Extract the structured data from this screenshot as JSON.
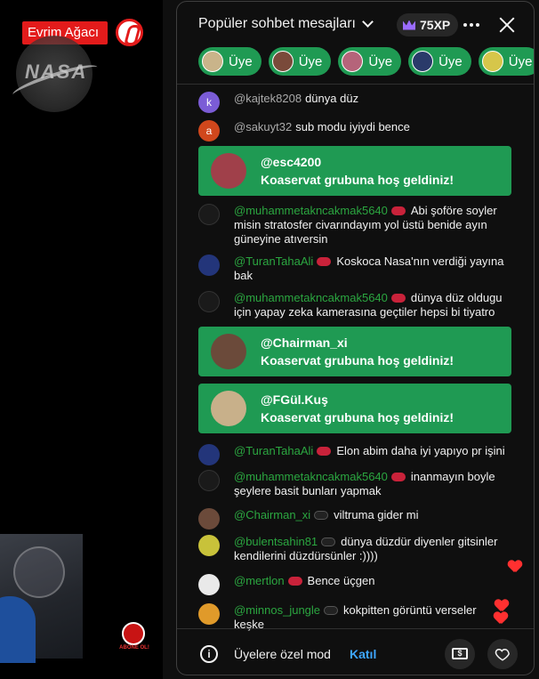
{
  "video": {
    "channel_badge": "Evrim Ağacı",
    "nasa_logo": "NASA",
    "subscribe_logo": "ABONE OL!"
  },
  "header": {
    "title": "Popüler sohbet mesajları",
    "xp": "75XP",
    "icons": [
      "chevron-down-icon",
      "crown-icon",
      "more-vert-icon",
      "close-icon"
    ]
  },
  "chips": [
    {
      "label": "Üye",
      "avatar_color": "#c9b48a"
    },
    {
      "label": "Üye",
      "avatar_color": "#7a4a3a"
    },
    {
      "label": "Üye",
      "avatar_color": "#b5647a"
    },
    {
      "label": "Üye",
      "avatar_color": "#2a3a6a"
    },
    {
      "label": "Üye",
      "avatar_color": "#d6c64a"
    }
  ],
  "messages": [
    {
      "type": "text",
      "avatar_letter": "k",
      "avatar_color": "#7b5cd6",
      "author": "@kajtek8208",
      "member": false,
      "text": "dünya düz"
    },
    {
      "type": "text",
      "avatar_letter": "a",
      "avatar_color": "#d0471c",
      "author": "@sakuyt32",
      "member": false,
      "text": "sub modu iyiydi bence"
    },
    {
      "type": "welcome",
      "author": "@esc4200",
      "text": "Koaservat grubuna hoş geldiniz!",
      "avatar_color": "#a0404a"
    },
    {
      "type": "text",
      "avatar_color": "#1a1a1a",
      "author": "@muhammetakncakmak5640",
      "member": true,
      "text": "Abi şoföre soyler misin stratosfer civarındayım yol üstü benide ayın güneyine atıversin"
    },
    {
      "type": "text",
      "avatar_color": "#23357a",
      "author": "@TuranTahaAli",
      "member": true,
      "text": "Koskoca Nasa'nın verdiği yayına bak"
    },
    {
      "type": "text",
      "avatar_color": "#1a1a1a",
      "author": "@muhammetakncakmak5640",
      "member": true,
      "text": "dünya düz oldugu için yapay zeka kamerasına geçtiler hepsi bi tiyatro"
    },
    {
      "type": "welcome",
      "author": "@Chairman_xi",
      "text": "Koaservat grubuna hoş geldiniz!",
      "avatar_color": "#6b4a3a"
    },
    {
      "type": "welcome",
      "author": "@FGül.Kuş",
      "text": "Koaservat grubuna hoş geldiniz!",
      "avatar_color": "#c8b08a"
    },
    {
      "type": "text",
      "avatar_color": "#23357a",
      "author": "@TuranTahaAli",
      "member": true,
      "text": "Elon abim daha iyi yapıyo pr işini"
    },
    {
      "type": "text",
      "avatar_color": "#1a1a1a",
      "author": "@muhammetakncakmak5640",
      "member": true,
      "text": "inanmayın boyle şeylere basit bunları yapmak"
    },
    {
      "type": "text",
      "avatar_color": "#6b4a3a",
      "author": "@Chairman_xi",
      "member": true,
      "text": "viltruma gider mi"
    },
    {
      "type": "text",
      "avatar_color": "#c8c23a",
      "author": "@bulentsahin81",
      "member": true,
      "text": "dünya düzdür diyenler gitsinler kendilerini düzdürsünler :))))"
    },
    {
      "type": "text",
      "avatar_color": "#e9e9e9",
      "author": "@mertlon",
      "member": true,
      "text": "Bence üçgen"
    },
    {
      "type": "text",
      "avatar_color": "#e09a2a",
      "author": "@minnos_jungle",
      "member": true,
      "text": "kokpitten görüntü verseler keşke"
    }
  ],
  "footer": {
    "members_only": "Üyelere özel mod",
    "join": "Katıl",
    "icons": [
      "info-icon",
      "super-chat-icon",
      "heart-icon"
    ]
  },
  "colors": {
    "member_green": "#1f9a53",
    "member_name": "#2ba640",
    "link_blue": "#3ea6ff",
    "background": "#0f0f0f"
  }
}
